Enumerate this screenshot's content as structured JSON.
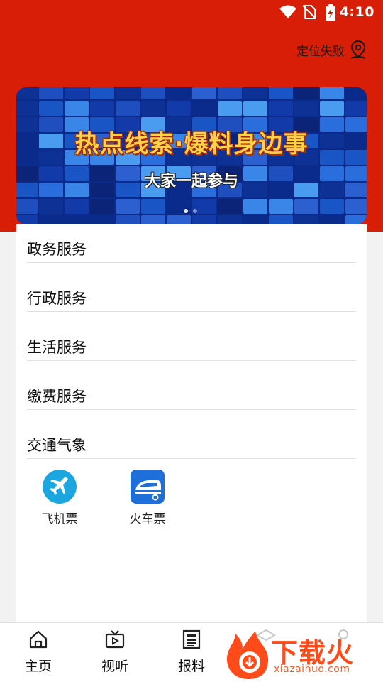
{
  "status_bar": {
    "time": "4:10"
  },
  "header": {
    "location_label": "定位失败",
    "location_icon": "map-pin-icon"
  },
  "banner": {
    "title": "热点线索·爆料身边事",
    "subtitle": "大家一起参与",
    "slide_count": 2,
    "active_slide": 1
  },
  "sections": [
    {
      "label": "政务服务"
    },
    {
      "label": "行政服务"
    },
    {
      "label": "生活服务"
    },
    {
      "label": "缴费服务"
    },
    {
      "label": "交通气象"
    }
  ],
  "transport_services": [
    {
      "label": "飞机票",
      "icon": "airplane-icon"
    },
    {
      "label": "火车票",
      "icon": "train-icon"
    }
  ],
  "bottom_nav": [
    {
      "label": "主页",
      "icon": "home-icon"
    },
    {
      "label": "视听",
      "icon": "tv-icon"
    },
    {
      "label": "报料",
      "icon": "newspaper-icon"
    }
  ],
  "watermark": {
    "text": "下载火",
    "subtext": "xiazaihuo.com"
  },
  "colors": {
    "brand_red": "#d81e06",
    "airplane_blue": "#1ba6e0",
    "train_blue": "#1e6fd9"
  }
}
